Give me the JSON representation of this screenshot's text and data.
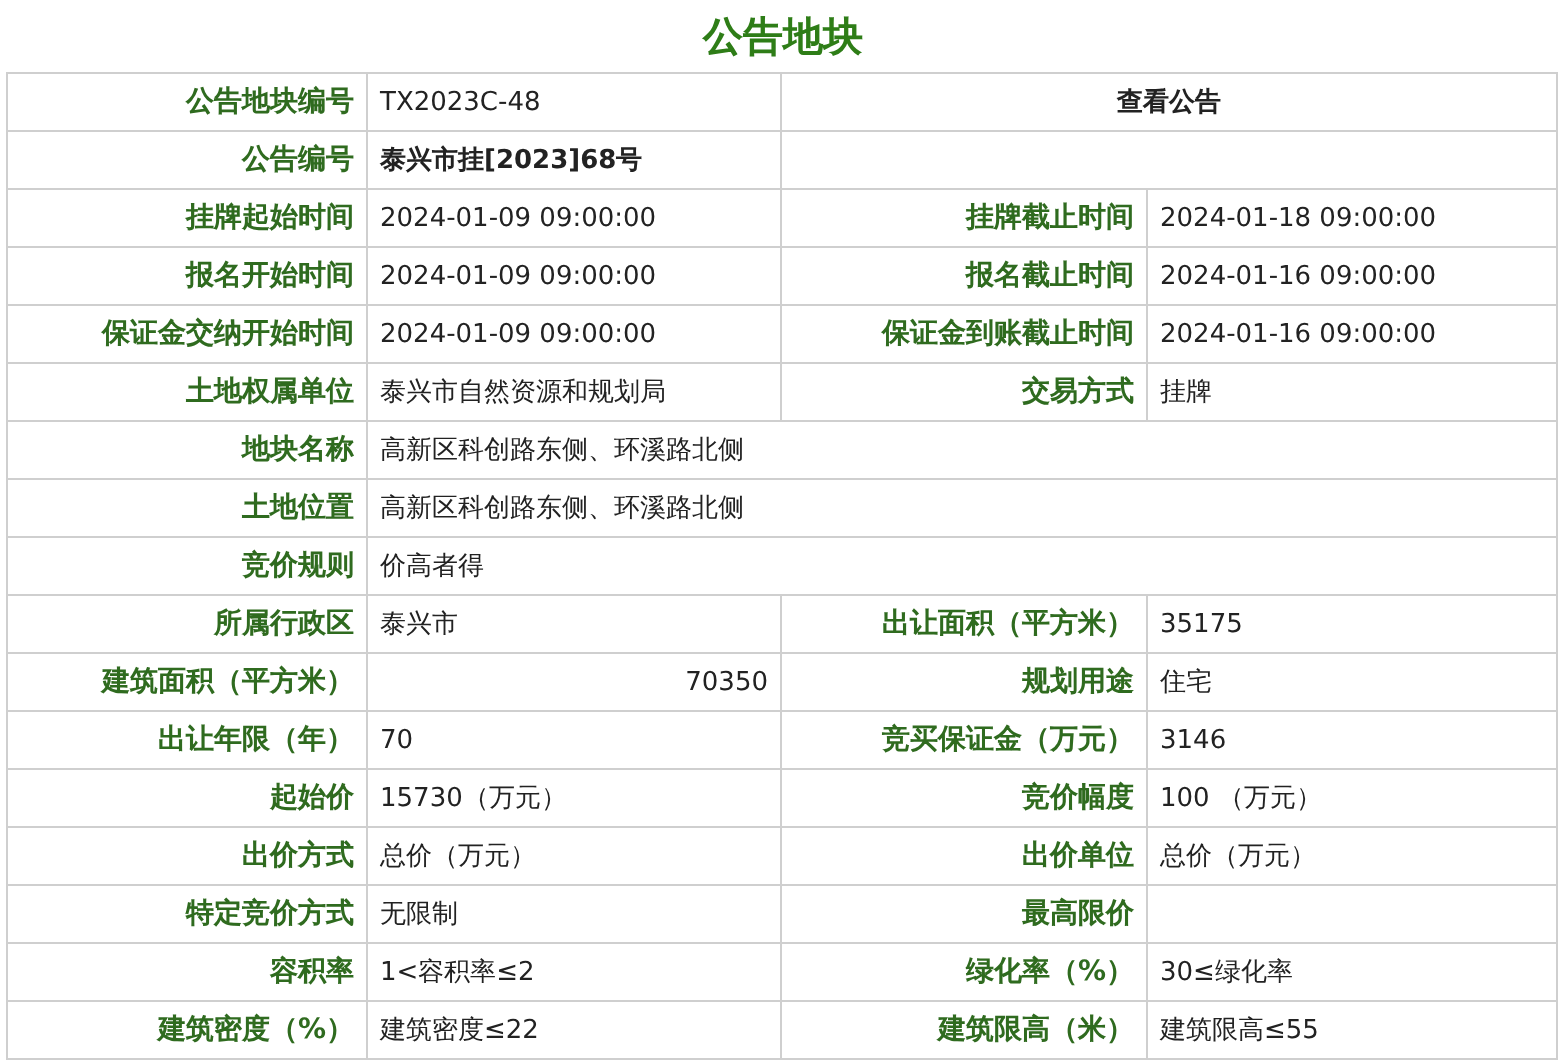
{
  "title": "公告地块",
  "rows": [
    {
      "cells": [
        {
          "kind": "label",
          "text": "公告地块编号"
        },
        {
          "kind": "value",
          "text": "TX2023C-48"
        },
        {
          "kind": "link",
          "text": "查看公告"
        }
      ]
    },
    {
      "cells": [
        {
          "kind": "label",
          "text": "公告编号"
        },
        {
          "kind": "strong",
          "text": "泰兴市挂[2023]68号"
        },
        {
          "kind": "empty"
        }
      ]
    },
    {
      "cells": [
        {
          "kind": "label",
          "text": "挂牌起始时间"
        },
        {
          "kind": "value",
          "text": "2024-01-09 09:00:00"
        },
        {
          "kind": "label",
          "text": "挂牌截止时间"
        },
        {
          "kind": "value",
          "text": "2024-01-18 09:00:00"
        }
      ]
    },
    {
      "cells": [
        {
          "kind": "label",
          "text": "报名开始时间"
        },
        {
          "kind": "value",
          "text": "2024-01-09 09:00:00"
        },
        {
          "kind": "label",
          "text": "报名截止时间"
        },
        {
          "kind": "value",
          "text": "2024-01-16 09:00:00"
        }
      ]
    },
    {
      "cells": [
        {
          "kind": "label",
          "text": "保证金交纳开始时间"
        },
        {
          "kind": "value",
          "text": "2024-01-09 09:00:00"
        },
        {
          "kind": "label",
          "text": "保证金到账截止时间"
        },
        {
          "kind": "value",
          "text": "2024-01-16 09:00:00"
        }
      ]
    },
    {
      "cells": [
        {
          "kind": "label",
          "text": "土地权属单位"
        },
        {
          "kind": "value",
          "text": "泰兴市自然资源和规划局"
        },
        {
          "kind": "label",
          "text": "交易方式"
        },
        {
          "kind": "value",
          "text": "挂牌"
        }
      ]
    },
    {
      "cells": [
        {
          "kind": "label",
          "text": "地块名称"
        },
        {
          "kind": "value",
          "text": "高新区科创路东侧、环溪路北侧"
        }
      ]
    },
    {
      "cells": [
        {
          "kind": "label",
          "text": "土地位置"
        },
        {
          "kind": "value",
          "text": "高新区科创路东侧、环溪路北侧"
        }
      ]
    },
    {
      "cells": [
        {
          "kind": "label",
          "text": "竞价规则"
        },
        {
          "kind": "value",
          "text": "价高者得"
        }
      ]
    },
    {
      "cells": [
        {
          "kind": "label",
          "text": "所属行政区"
        },
        {
          "kind": "value",
          "text": "泰兴市"
        },
        {
          "kind": "label",
          "text": "出让面积（平方米）"
        },
        {
          "kind": "value",
          "text": "35175"
        }
      ]
    },
    {
      "cells": [
        {
          "kind": "label",
          "text": "建筑面积（平方米）"
        },
        {
          "kind": "number",
          "text": "70350"
        },
        {
          "kind": "label",
          "text": "规划用途"
        },
        {
          "kind": "value",
          "text": "住宅"
        }
      ]
    },
    {
      "cells": [
        {
          "kind": "label",
          "text": "出让年限（年）"
        },
        {
          "kind": "value",
          "text": "70"
        },
        {
          "kind": "label",
          "text": "竞买保证金（万元）"
        },
        {
          "kind": "value",
          "text": "3146"
        }
      ]
    },
    {
      "cells": [
        {
          "kind": "label",
          "text": "起始价"
        },
        {
          "kind": "value",
          "text": "15730（万元）"
        },
        {
          "kind": "label",
          "text": "竞价幅度"
        },
        {
          "kind": "value",
          "text": "100 （万元）"
        }
      ]
    },
    {
      "cells": [
        {
          "kind": "label",
          "text": "出价方式"
        },
        {
          "kind": "value",
          "text": "总价（万元）"
        },
        {
          "kind": "label",
          "text": "出价单位"
        },
        {
          "kind": "value",
          "text": "总价（万元）"
        }
      ]
    },
    {
      "cells": [
        {
          "kind": "label",
          "text": "特定竞价方式"
        },
        {
          "kind": "value",
          "text": "无限制"
        },
        {
          "kind": "label",
          "text": "最高限价"
        },
        {
          "kind": "empty"
        }
      ]
    },
    {
      "cells": [
        {
          "kind": "label",
          "text": "容积率"
        },
        {
          "kind": "value",
          "text": "1<容积率≤2"
        },
        {
          "kind": "label",
          "text": "绿化率（%）"
        },
        {
          "kind": "value",
          "text": "30≤绿化率"
        }
      ]
    },
    {
      "cells": [
        {
          "kind": "label",
          "text": "建筑密度（%）"
        },
        {
          "kind": "value",
          "text": "建筑密度≤22"
        },
        {
          "kind": "label",
          "text": "建筑限高（米）"
        },
        {
          "kind": "value",
          "text": "建筑限高≤55"
        }
      ]
    }
  ]
}
